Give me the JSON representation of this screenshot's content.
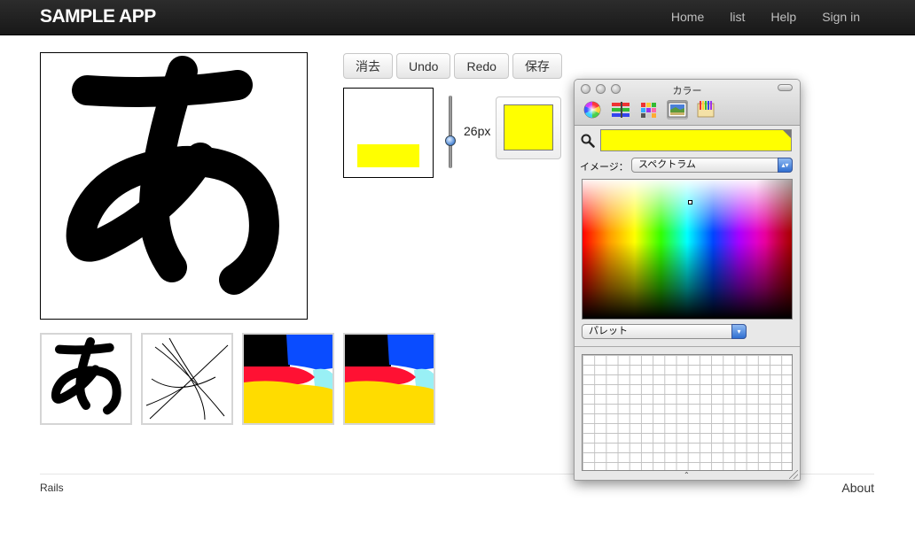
{
  "navbar": {
    "brand": "SAMPLE APP",
    "links": [
      "Home",
      "list",
      "Help",
      "Sign in"
    ]
  },
  "canvas": {
    "glyph": "あ"
  },
  "toolbar": {
    "clear_label": "消去",
    "undo_label": "Undo",
    "redo_label": "Redo",
    "save_label": "保存"
  },
  "brush": {
    "size_label": "26px",
    "color": "#ffff00"
  },
  "thumbnails": {
    "first_glyph": "あ"
  },
  "footer": {
    "left": "Rails",
    "right": "About"
  },
  "color_panel": {
    "title": "カラー",
    "mode_icons": [
      "color-wheel-icon",
      "color-sliders-icon",
      "color-palettes-icon",
      "image-palettes-icon",
      "crayons-icon"
    ],
    "selected_mode": "image-palettes-icon",
    "current_color": "#ffff00",
    "image_label": "イメージ：",
    "image_select": "スペクトラム",
    "palette_select": "パレット"
  }
}
